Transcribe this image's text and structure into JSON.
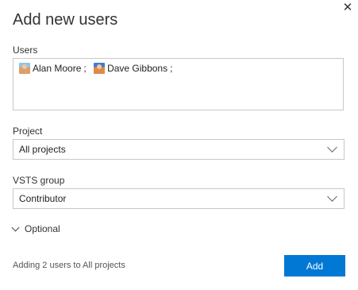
{
  "dialog": {
    "title": "Add new users",
    "close_label": "✕"
  },
  "users": {
    "label": "Users",
    "selected": [
      {
        "name": "Alan Moore",
        "separator": ";"
      },
      {
        "name": "Dave Gibbons",
        "separator": ";"
      }
    ]
  },
  "project": {
    "label": "Project",
    "value": "All projects"
  },
  "group": {
    "label": "VSTS group",
    "value": "Contributor"
  },
  "optional": {
    "label": "Optional"
  },
  "footer": {
    "status": "Adding 2 users to All projects",
    "add_label": "Add",
    "accent": "#0078d4"
  }
}
